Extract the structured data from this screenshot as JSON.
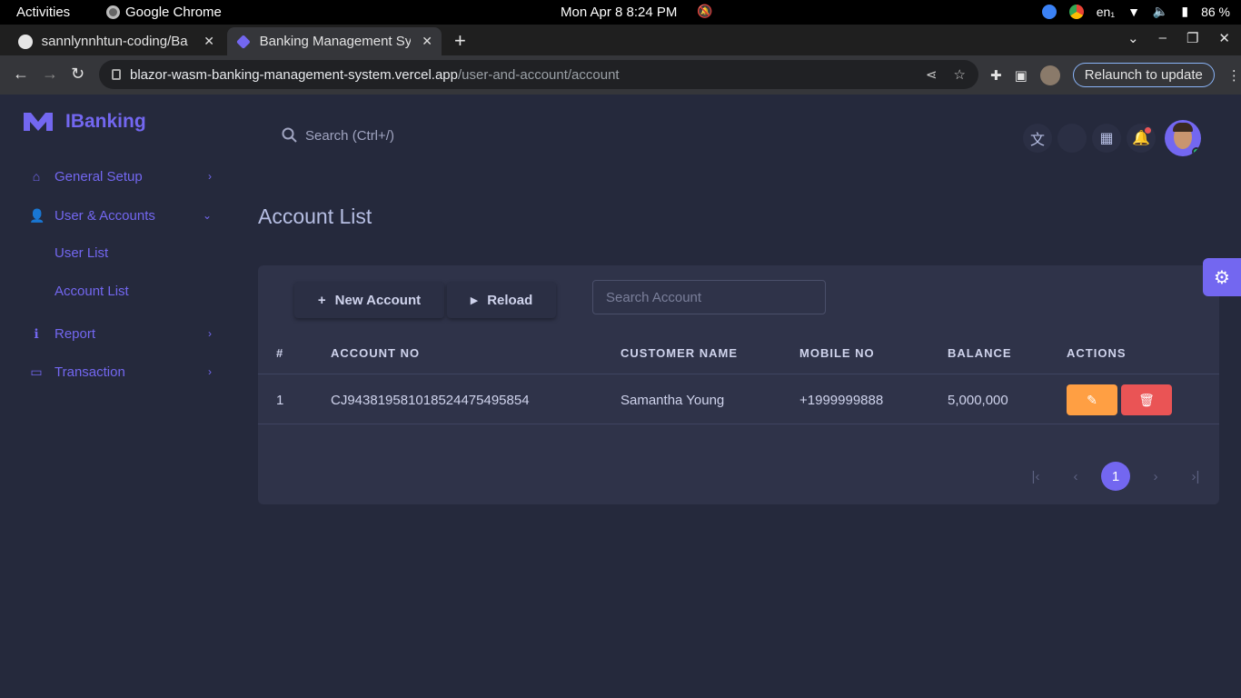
{
  "os": {
    "activities": "Activities",
    "app_name": "Google Chrome",
    "clock": "Mon Apr 8   8:24 PM",
    "lang": "en₁",
    "battery": "86 %"
  },
  "browser": {
    "tabs": [
      {
        "title": "sannlynnhtun-coding/Ba"
      },
      {
        "title": "Banking Management Sy"
      }
    ],
    "url_host": "blazor-wasm-banking-management-system.vercel.app",
    "url_path": "/user-and-account/account",
    "relaunch_label": "Relaunch to update"
  },
  "sidebar": {
    "brand": "IBanking",
    "items": [
      {
        "label": "General Setup",
        "icon": "home-icon"
      },
      {
        "label": "User & Accounts",
        "icon": "user-icon"
      },
      {
        "label": "Report",
        "icon": "info-icon"
      },
      {
        "label": "Transaction",
        "icon": "credit-card-icon"
      }
    ],
    "sub_items": [
      {
        "label": "User List"
      },
      {
        "label": "Account List"
      }
    ]
  },
  "header": {
    "search_placeholder": "Search (Ctrl+/)"
  },
  "page": {
    "title": "Account List",
    "new_account_label": "New Account",
    "reload_label": "Reload",
    "search_placeholder": "Search Account"
  },
  "table": {
    "columns": [
      "#",
      "ACCOUNT NO",
      "CUSTOMER NAME",
      "MOBILE NO",
      "BALANCE",
      "ACTIONS"
    ],
    "rows": [
      {
        "num": "1",
        "account_no": "CJ943819581018524475495854",
        "customer": "Samantha Young",
        "mobile": "+1999999888",
        "balance": "5,000,000"
      }
    ]
  },
  "pagination": {
    "current_page": "1"
  },
  "colors": {
    "accent": "#7367f0",
    "background": "#25293c",
    "card": "#2f3349",
    "edit": "#ff9f43",
    "delete": "#ea5455"
  }
}
